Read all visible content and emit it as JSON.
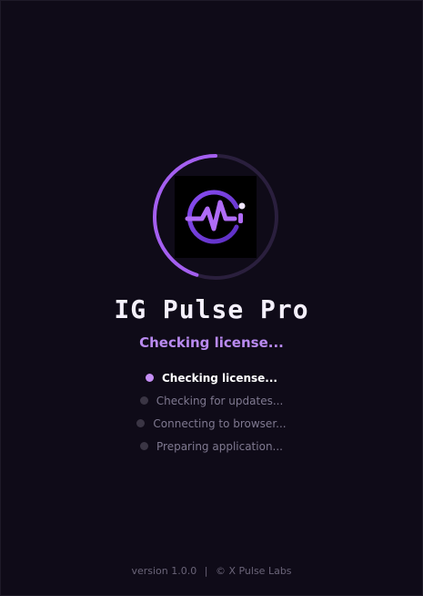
{
  "app": {
    "title": "IG Pulse Pro",
    "status_text": "Checking license..."
  },
  "progress": {
    "fraction": 0.45
  },
  "steps": [
    {
      "label": "Checking license...",
      "state": "active"
    },
    {
      "label": "Checking for updates...",
      "state": "pending"
    },
    {
      "label": "Connecting to browser...",
      "state": "pending"
    },
    {
      "label": "Preparing application...",
      "state": "pending"
    }
  ],
  "footer": {
    "version": "version 1.0.0",
    "separator": "|",
    "copyright": "© X Pulse Labs"
  },
  "colors": {
    "background": "#0f0b18",
    "accent": "#b98af0",
    "active_dot": "#c58ef5",
    "pending_dot": "#3a3544",
    "ring_track": "#2a1f3d",
    "ring_progress": "#a45ff0"
  },
  "icons": {
    "logo": "pulse-wave-logo-icon"
  }
}
